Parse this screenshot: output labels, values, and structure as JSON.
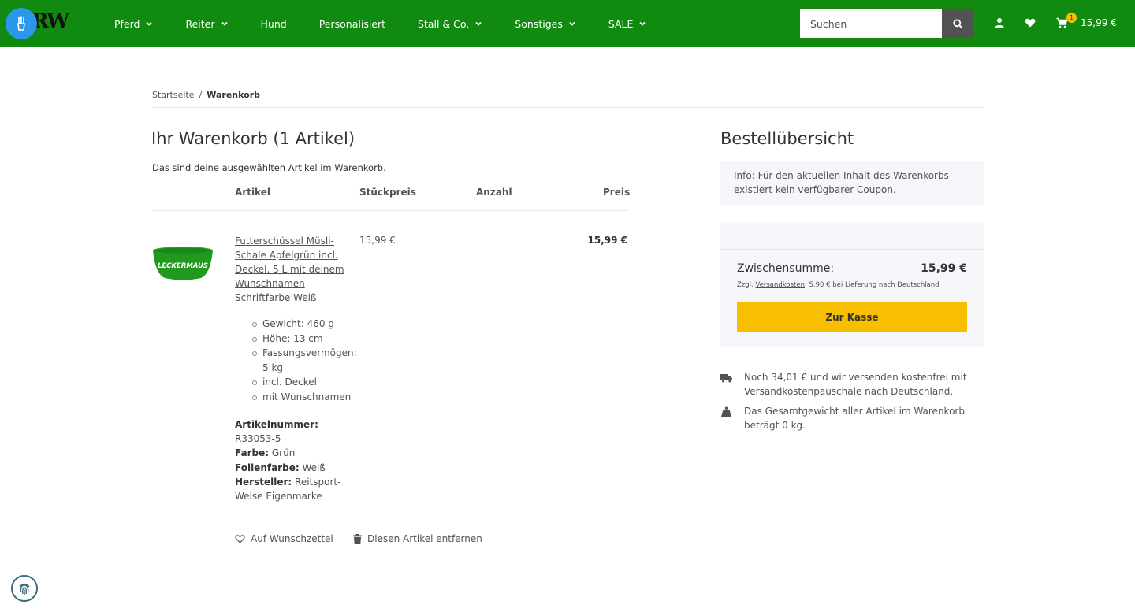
{
  "header": {
    "logo_text": "RW",
    "nav": [
      {
        "label": "Pferd",
        "dropdown": true
      },
      {
        "label": "Reiter",
        "dropdown": true
      },
      {
        "label": "Hund",
        "dropdown": false
      },
      {
        "label": "Personalisiert",
        "dropdown": false
      },
      {
        "label": "Stall & Co.",
        "dropdown": true
      },
      {
        "label": "Sonstiges",
        "dropdown": true
      },
      {
        "label": "SALE",
        "dropdown": true
      }
    ],
    "search_placeholder": "Suchen",
    "cart_count": "1",
    "cart_total": "15,99 €",
    "icons": [
      "accessibility-icon",
      "search-icon",
      "user-icon",
      "heart-icon",
      "cart-icon"
    ]
  },
  "breadcrumb": {
    "home": "Startseite",
    "separator": "/",
    "current": "Warenkorb"
  },
  "cart": {
    "title": "Ihr Warenkorb (1 Artikel)",
    "subtitle": "Das sind deine ausgewählten Artikel im Warenkorb.",
    "columns": {
      "article": "Artikel",
      "unit_price": "Stückpreis",
      "quantity": "Anzahl",
      "price": "Preis"
    },
    "item": {
      "image_label": "LECKERMAUS",
      "name": "Futterschüssel Müsli-Schale Apfelgrün incl. Deckel, 5 L mit deinem Wunschnamen Schriftfarbe Weiß",
      "attributes": [
        "Gewicht: 460 g",
        "Höhe: 13 cm",
        "Fassungsvermögen: 5 kg",
        "incl. Deckel",
        "mit Wunschnamen"
      ],
      "meta": [
        {
          "label": "Artikelnummer:",
          "value": "R33053-5"
        },
        {
          "label": "Farbe:",
          "value": "Grün"
        },
        {
          "label": "Folienfarbe:",
          "value": "Weiß"
        },
        {
          "label": "Hersteller:",
          "value": "Reitsport-Weise Eigenmarke"
        }
      ],
      "unit_price": "15,99 €",
      "line_price": "15,99 €",
      "wishlist_label": "Auf Wunschzettel",
      "remove_label": "Diesen Artikel entfernen"
    }
  },
  "summary": {
    "title": "Bestellübersicht",
    "coupon_info": "Info: Für den aktuellen Inhalt des Warenkorbs existiert kein verfügbarer Coupon.",
    "subtotal_label": "Zwischensumme:",
    "subtotal_value": "15,99 €",
    "shipping_prefix": "Zzgl.",
    "shipping_link": "Versandkosten",
    "shipping_suffix": ": 5,90 € bei Lieferung nach Deutschland",
    "checkout_label": "Zur Kasse",
    "free_shipping_note": "Noch 34,01 € und wir versenden kostenfrei mit Versandkostenpauschale nach Deutschland.",
    "weight_note": "Das Gesamtgewicht aller Artikel im Warenkorb beträgt 0 kg."
  },
  "colors": {
    "brand_green": "#108b10",
    "accent_yellow": "#f8bf00",
    "a11y_blue": "#2b97ea"
  }
}
